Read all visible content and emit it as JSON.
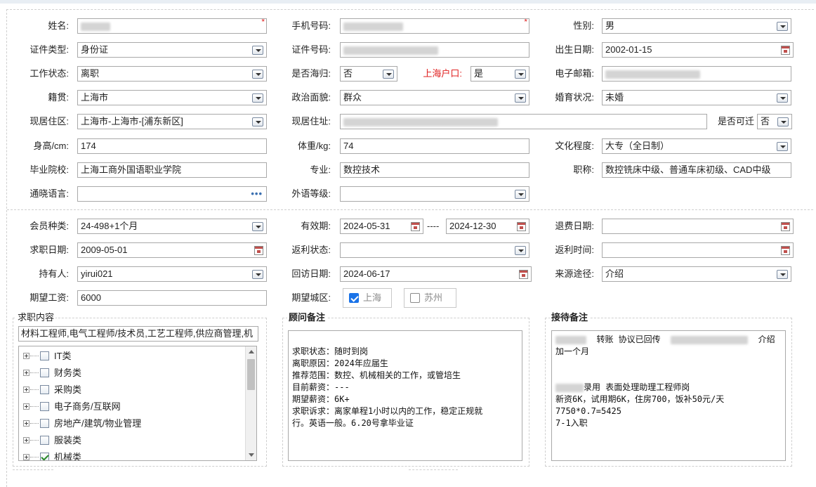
{
  "row1": {
    "name_label": "姓名:",
    "name_required": "*",
    "phone_label": "手机号码:",
    "phone_required": "*",
    "gender_label": "性别:",
    "gender_value": "男"
  },
  "row2": {
    "id_type_label": "证件类型:",
    "id_type_value": "身份证",
    "id_no_label": "证件号码:",
    "birth_label": "出生日期:",
    "birth_value": "2002-01-15"
  },
  "row3": {
    "work_status_label": "工作状态:",
    "work_status_value": "离职",
    "overseas_label": "是否海归:",
    "overseas_value": "否",
    "hukou_label": "上海户口:",
    "hukou_value": "是",
    "email_label": "电子邮箱:"
  },
  "row4": {
    "native_label": "籍贯:",
    "native_value": "上海市",
    "political_label": "政治面貌:",
    "political_value": "群众",
    "marital_label": "婚育状况:",
    "marital_value": "未婚"
  },
  "row5": {
    "district_label": "现居住区:",
    "district_value": "上海市-上海市-[浦东新区]",
    "address_label": "现居住址:",
    "relocate_label": "是否可迁",
    "relocate_value": "否"
  },
  "row6": {
    "height_label": "身高/cm:",
    "height_value": "174",
    "weight_label": "体重/kg:",
    "weight_value": "74",
    "education_label": "文化程度:",
    "education_value": "大专（全日制）"
  },
  "row7": {
    "school_label": "毕业院校:",
    "school_value": "上海工商外国语职业学院",
    "major_label": "专业:",
    "major_value": "数控技术",
    "title_label": "职称:",
    "title_value": "数控铣床中级、普通车床初级、CAD中级"
  },
  "row8": {
    "lang_label": "通晓语言:",
    "lang_more": "•••",
    "foreign_label": "外语等级:"
  },
  "member": {
    "type_label": "会员种类:",
    "type_value": "24-498+1个月",
    "valid_label": "有效期:",
    "valid_from": "2024-05-31",
    "valid_sep": "----",
    "valid_to": "2024-12-30",
    "refund_date_label": "退费日期:",
    "job_date_label": "求职日期:",
    "job_date_value": "2009-05-01",
    "rebate_status_label": "返利状态:",
    "rebate_time_label": "返利时间:",
    "holder_label": "持有人:",
    "holder_value": "yirui021",
    "visit_label": "回访日期:",
    "visit_value": "2024-06-17",
    "source_label": "来源途径:",
    "source_value": "介绍",
    "salary_label": "期望工资:",
    "salary_value": "6000",
    "city_label": "期望城区:",
    "city_options": [
      {
        "label": "上海",
        "checked": true
      },
      {
        "label": "苏州",
        "checked": false
      }
    ]
  },
  "job_content": {
    "legend": "求职内容",
    "text": "材料工程师,电气工程师/技术员,工艺工程师,供应商管理,机",
    "tree": [
      {
        "label": "IT类",
        "checked": false
      },
      {
        "label": "财务类",
        "checked": false
      },
      {
        "label": "采购类",
        "checked": false
      },
      {
        "label": "电子商务/互联网",
        "checked": false
      },
      {
        "label": "房地产/建筑/物业管理",
        "checked": false
      },
      {
        "label": "服装类",
        "checked": false
      },
      {
        "label": "机械类",
        "checked": true
      }
    ]
  },
  "advisor_notes": {
    "legend": "顾问备注",
    "lines": [
      "",
      "求职状态：随时到岗",
      "离职原因：2024年应届生",
      "推荐范围：数控、机械相关的工作，或管培生",
      "目前薪资：---",
      "期望薪资：6K+",
      "求职诉求：离家单程1小时以内的工作，稳定正规就",
      "行。英语一般。6.20号拿毕业证"
    ]
  },
  "reception_notes": {
    "legend": "接待备注",
    "line1_a": "转账 协议已回传",
    "line1_b": "介绍",
    "line2": "加一个月",
    "line5": "录用 表面处理助理工程师岗",
    "line6": "新资6K，试用期6K，住房700，饭补50元/天",
    "line7": "7750*0.7=5425",
    "line8": "7-1入职"
  }
}
